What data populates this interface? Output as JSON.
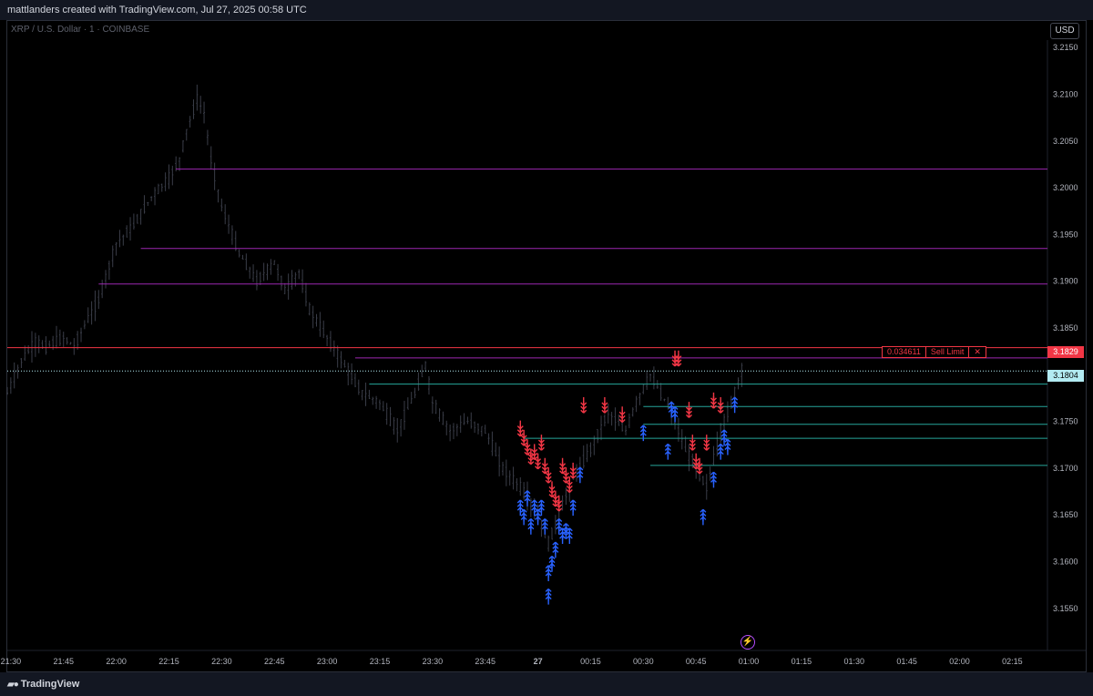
{
  "header": {
    "caption": "mattlanders created with TradingView.com, Jul 27, 2025 00:58 UTC"
  },
  "symbol": {
    "name": "XRP",
    "quote": "U.S. Dollar",
    "interval": "1",
    "exchange": "COINBASE",
    "separator": " / ",
    "dot": " · "
  },
  "currency_button": "USD",
  "footer": {
    "brand": "TradingView",
    "logo": "tradingview-logo-icon"
  },
  "order": {
    "quantity": "0.034611",
    "label": "Sell Limit",
    "close": "✕",
    "price_label": "3.1829"
  },
  "last_price_label": "3.1804",
  "colors": {
    "background": "#000000",
    "candle": "#3a3d48",
    "sell_line": "#f23645",
    "resistance_lines": "#9c27b0",
    "support_lines": "#26a69a",
    "sell_arrow": "#f23645",
    "buy_arrow": "#2962ff",
    "last_price": "#b2ebf2"
  },
  "chart_data": {
    "type": "candlestick",
    "title": "XRP / U.S. Dollar · 1 · COINBASE",
    "ylim": [
      3.1505,
      3.2158
    ],
    "y_ticks": [
      "3.1550",
      "3.1600",
      "3.1650",
      "3.1700",
      "3.1750",
      "3.1800",
      "3.1850",
      "3.1900",
      "3.1950",
      "3.2000",
      "3.2050",
      "3.2100",
      "3.2150"
    ],
    "x_ticks": [
      "21:30",
      "21:45",
      "22:00",
      "22:15",
      "22:30",
      "22:45",
      "23:00",
      "23:15",
      "23:30",
      "23:45",
      "27",
      "00:15",
      "00:30",
      "00:45",
      "01:00",
      "01:15",
      "01:30",
      "01:45",
      "02:00",
      "02:15"
    ],
    "x_range": [
      "21:29",
      "02:25"
    ],
    "price_anchors": [
      [
        "21:29",
        3.178
      ],
      [
        "21:33",
        3.1815
      ],
      [
        "21:37",
        3.1835
      ],
      [
        "21:40",
        3.183
      ],
      [
        "21:45",
        3.184
      ],
      [
        "21:48",
        3.183
      ],
      [
        "21:52",
        3.186
      ],
      [
        "21:55",
        3.188
      ],
      [
        "22:00",
        3.194
      ],
      [
        "22:05",
        3.196
      ],
      [
        "22:10",
        3.199
      ],
      [
        "22:15",
        3.201
      ],
      [
        "22:18",
        3.203
      ],
      [
        "22:20",
        3.206
      ],
      [
        "22:23",
        3.2095
      ],
      [
        "22:25",
        3.208
      ],
      [
        "22:27",
        3.203
      ],
      [
        "22:30",
        3.198
      ],
      [
        "22:35",
        3.193
      ],
      [
        "22:40",
        3.19
      ],
      [
        "22:45",
        3.192
      ],
      [
        "22:48",
        3.189
      ],
      [
        "22:52",
        3.191
      ],
      [
        "22:55",
        3.187
      ],
      [
        "23:00",
        3.184
      ],
      [
        "23:05",
        3.181
      ],
      [
        "23:10",
        3.178
      ],
      [
        "23:15",
        3.177
      ],
      [
        "23:20",
        3.174
      ],
      [
        "23:25",
        3.178
      ],
      [
        "23:28",
        3.181
      ],
      [
        "23:30",
        3.177
      ],
      [
        "23:35",
        3.174
      ],
      [
        "23:40",
        3.175
      ],
      [
        "23:45",
        3.174
      ],
      [
        "23:50",
        3.17
      ],
      [
        "23:55",
        3.168
      ],
      [
        "00:00",
        3.165
      ],
      [
        "00:03",
        3.162
      ],
      [
        "00:06",
        3.165
      ],
      [
        "00:10",
        3.169
      ],
      [
        "00:15",
        3.172
      ],
      [
        "00:20",
        3.176
      ],
      [
        "00:25",
        3.174
      ],
      [
        "00:28",
        3.177
      ],
      [
        "00:32",
        3.18
      ],
      [
        "00:35",
        3.178
      ],
      [
        "00:38",
        3.176
      ],
      [
        "00:42",
        3.172
      ],
      [
        "00:45",
        3.17
      ],
      [
        "00:48",
        3.168
      ],
      [
        "00:52",
        3.174
      ],
      [
        "00:55",
        3.177
      ],
      [
        "00:58",
        3.1804
      ]
    ],
    "horizontal_lines": [
      {
        "price": 3.202,
        "start": "22:17",
        "color": "resistance"
      },
      {
        "price": 3.1935,
        "start": "22:07",
        "color": "resistance"
      },
      {
        "price": 3.1897,
        "start": "21:55",
        "color": "resistance"
      },
      {
        "price": 3.1829,
        "start": "21:29",
        "color": "sell"
      },
      {
        "price": 3.1818,
        "start": "23:08",
        "color": "resistance"
      },
      {
        "price": 3.179,
        "start": "23:12",
        "color": "support"
      },
      {
        "price": 3.1766,
        "start": "00:30",
        "color": "support"
      },
      {
        "price": 3.1747,
        "start": "00:30",
        "color": "support"
      },
      {
        "price": 3.1732,
        "start": "23:56",
        "color": "support"
      },
      {
        "price": 3.1703,
        "start": "00:32",
        "color": "support"
      }
    ],
    "last_price": 3.1804,
    "sell_signals": [
      [
        "23:55",
        3.174
      ],
      [
        "23:56",
        3.173
      ],
      [
        "23:57",
        3.172
      ],
      [
        "23:58",
        3.171
      ],
      [
        "23:59",
        3.1715
      ],
      [
        "00:00",
        3.1705
      ],
      [
        "00:01",
        3.1725
      ],
      [
        "00:02",
        3.17
      ],
      [
        "00:03",
        3.169
      ],
      [
        "00:04",
        3.1675
      ],
      [
        "00:05",
        3.1665
      ],
      [
        "00:06",
        3.166
      ],
      [
        "00:07",
        3.17
      ],
      [
        "00:08",
        3.169
      ],
      [
        "00:09",
        3.168
      ],
      [
        "00:10",
        3.1695
      ],
      [
        "00:13",
        3.1765
      ],
      [
        "00:19",
        3.1765
      ],
      [
        "00:24",
        3.1755
      ],
      [
        "00:39",
        3.1815
      ],
      [
        "00:40",
        3.1815
      ],
      [
        "00:43",
        3.176
      ],
      [
        "00:44",
        3.1725
      ],
      [
        "00:45",
        3.1705
      ],
      [
        "00:46",
        3.17
      ],
      [
        "00:48",
        3.1725
      ],
      [
        "00:50",
        3.177
      ],
      [
        "00:52",
        3.1765
      ]
    ],
    "buy_signals": [
      [
        "23:55",
        3.166
      ],
      [
        "23:56",
        3.165
      ],
      [
        "23:57",
        3.167
      ],
      [
        "23:58",
        3.164
      ],
      [
        "23:59",
        3.166
      ],
      [
        "00:00",
        3.165
      ],
      [
        "00:01",
        3.166
      ],
      [
        "00:02",
        3.164
      ],
      [
        "00:03",
        3.159
      ],
      [
        "00:03",
        3.1565
      ],
      [
        "00:04",
        3.16
      ],
      [
        "00:05",
        3.1615
      ],
      [
        "00:06",
        3.164
      ],
      [
        "00:07",
        3.163
      ],
      [
        "00:08",
        3.1635
      ],
      [
        "00:09",
        3.163
      ],
      [
        "00:10",
        3.166
      ],
      [
        "00:12",
        3.1695
      ],
      [
        "00:30",
        3.174
      ],
      [
        "00:37",
        3.172
      ],
      [
        "00:38",
        3.1765
      ],
      [
        "00:39",
        3.176
      ],
      [
        "00:47",
        3.165
      ],
      [
        "00:50",
        3.169
      ],
      [
        "00:52",
        3.172
      ],
      [
        "00:53",
        3.1735
      ],
      [
        "00:54",
        3.1725
      ],
      [
        "00:56",
        3.177
      ]
    ]
  }
}
